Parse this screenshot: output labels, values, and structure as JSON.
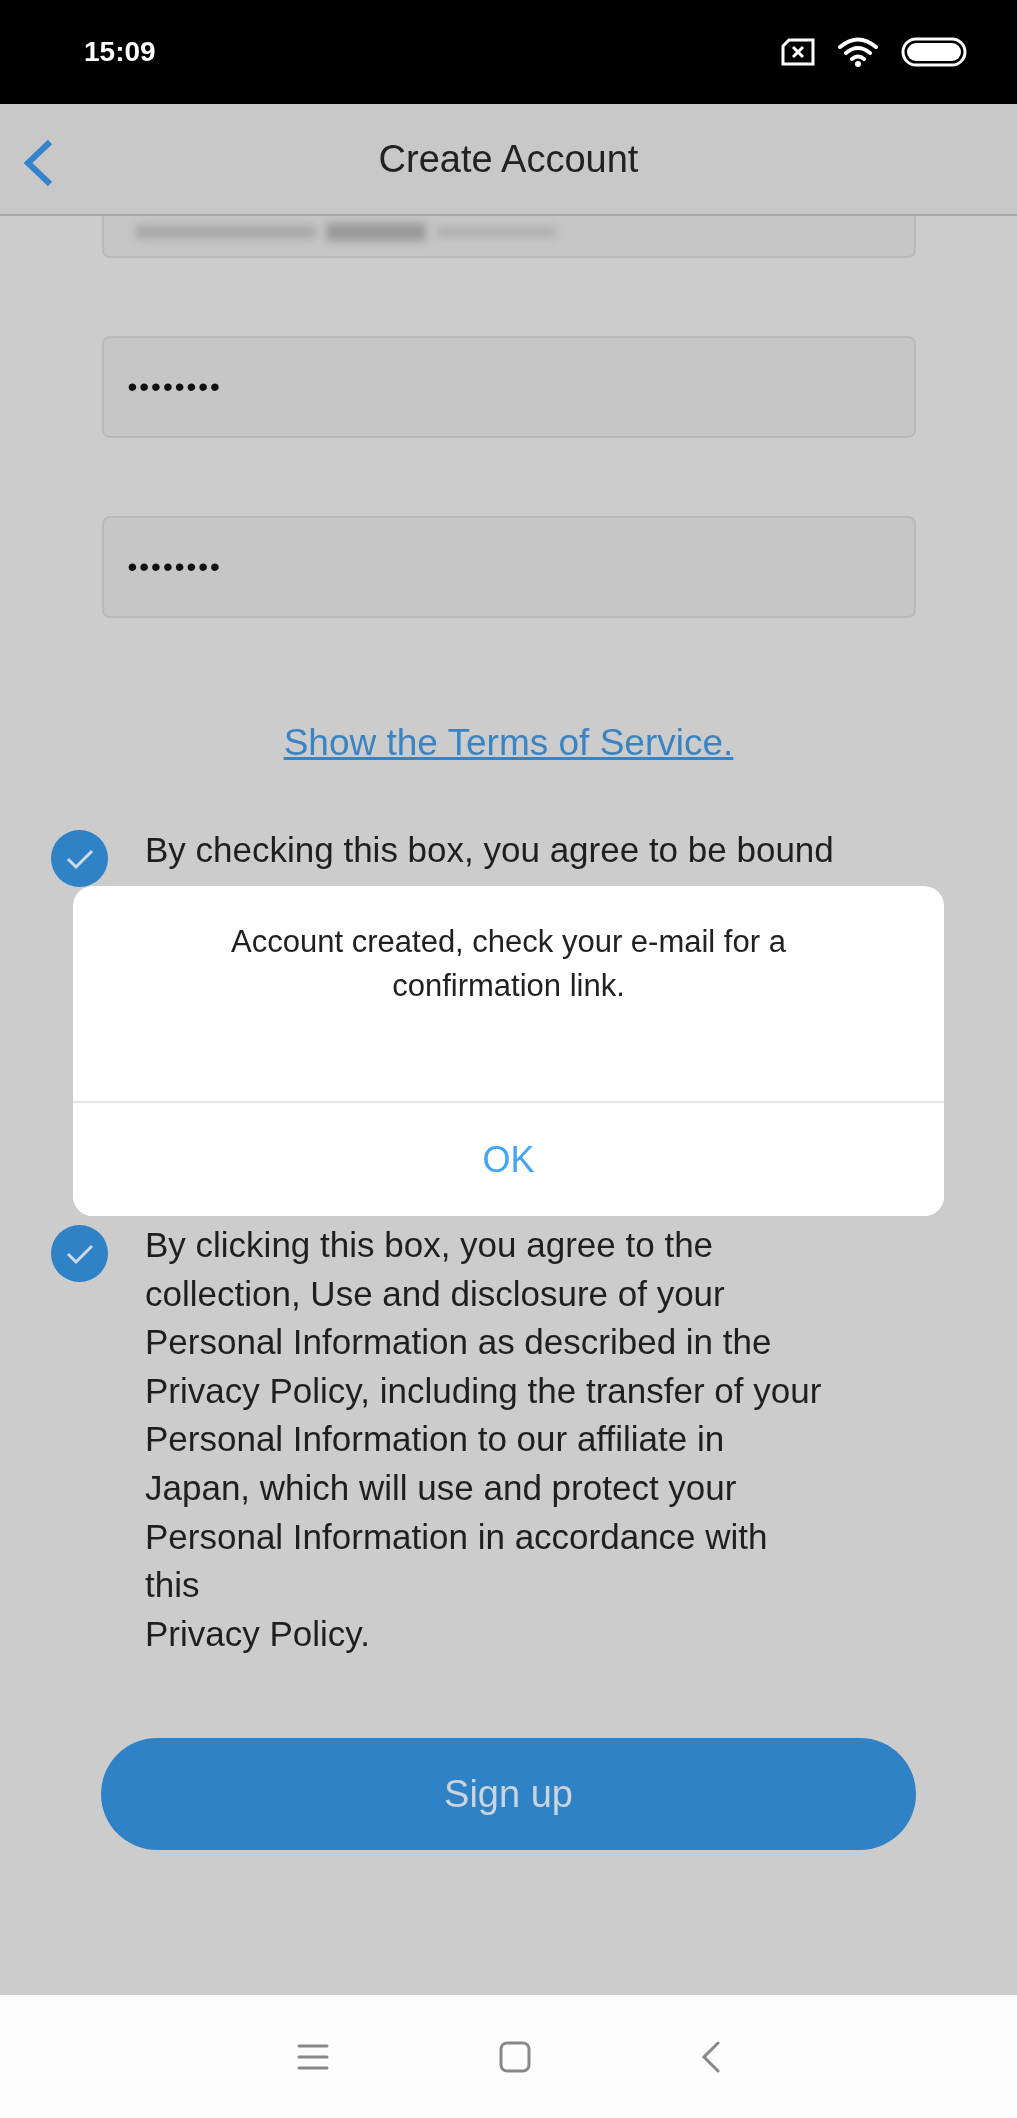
{
  "status_bar": {
    "time": "15:09"
  },
  "app_bar": {
    "title": "Create Account"
  },
  "fields": [
    {
      "kind": "blurred"
    },
    {
      "kind": "password",
      "value": "••••••••"
    },
    {
      "kind": "password",
      "value": "••••••••"
    }
  ],
  "terms_link": "Show the Terms of Service.",
  "checkboxes": [
    {
      "label": "By checking this box, you agree to be bound",
      "checked": true
    },
    {
      "label": "By clicking this box, you agree to the\ncollection, Use and disclosure of your\nPersonal Information as described in the\nPrivacy Policy, including the transfer of your\nPersonal Information to our affiliate in\nJapan, which will use and protect your\nPersonal Information in accordance with\nthis\nPrivacy Policy.",
      "checked": true
    }
  ],
  "signup_button": "Sign up",
  "dialog": {
    "message": "Account created, check your e-mail for a confirmation link.",
    "button": "OK"
  }
}
